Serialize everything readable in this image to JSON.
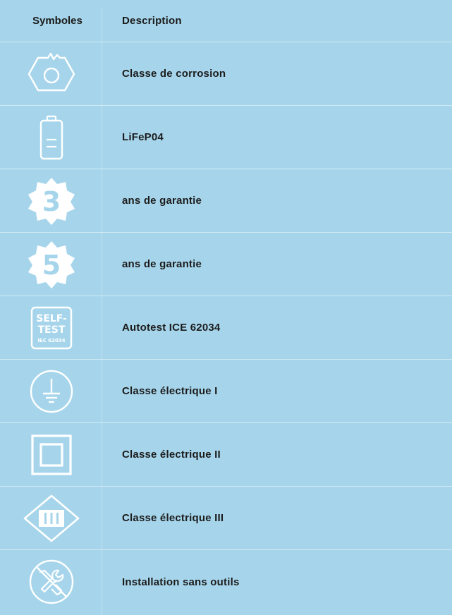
{
  "header": {
    "symbols_label": "Symboles",
    "description_label": "Description"
  },
  "rows": [
    {
      "icon": "corrosion-class-icon",
      "label": "Classe de corrosion"
    },
    {
      "icon": "battery-icon",
      "label": "LiFeP04"
    },
    {
      "icon": "warranty-3-icon",
      "badge": "3",
      "label": "ans de garantie"
    },
    {
      "icon": "warranty-5-icon",
      "badge": "5",
      "label": "ans de garantie"
    },
    {
      "icon": "self-test-icon",
      "badge_line1": "SELF-",
      "badge_line2": "TEST",
      "badge_line3": "IEC 62034",
      "label": "Autotest ICE 62034"
    },
    {
      "icon": "earth-ground-icon",
      "label": "Classe électrique I"
    },
    {
      "icon": "double-square-icon",
      "label": "Classe électrique II"
    },
    {
      "icon": "diamond-iii-icon",
      "label": "Classe électrique III"
    },
    {
      "icon": "no-tools-icon",
      "label": "Installation sans outils"
    }
  ],
  "colors": {
    "background": "#a6d5eb",
    "icon_white": "#ffffff",
    "divider": "#d2eaf5"
  }
}
